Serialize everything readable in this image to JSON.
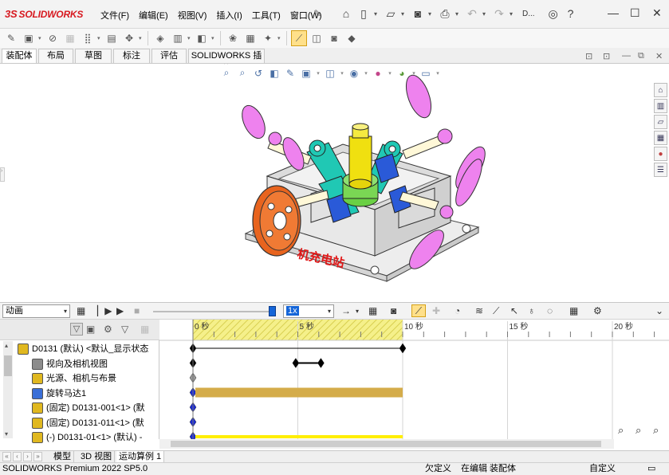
{
  "app": {
    "logo_prefix": "3S",
    "logo_text": "SOLIDWORKS",
    "user_short": "D..."
  },
  "menu": [
    "文件(F)",
    "编辑(E)",
    "视图(V)",
    "插入(I)",
    "工具(T)",
    "窗口(W)"
  ],
  "tabs": [
    "装配体",
    "布局",
    "草图",
    "标注",
    "评估",
    "SOLIDWORKS 插件"
  ],
  "viewport": {
    "watermark": "机充电站"
  },
  "motion_toolbar": {
    "study_type": "动画",
    "speed": "1x"
  },
  "tree": {
    "rows": [
      {
        "label": "D0131 (默认) <默认_显示状态",
        "expand": "▾"
      },
      {
        "label": "视向及相机视图",
        "expand": ""
      },
      {
        "label": "光源、相机与布景",
        "expand": "▸"
      },
      {
        "label": "旋转马达1",
        "expand": ""
      },
      {
        "label": "(固定) D0131-001<1> (默",
        "expand": "▸"
      },
      {
        "label": "(固定) D0131-011<1> (默",
        "expand": "▸"
      },
      {
        "label": "(-) D0131-01<1> (默认) -",
        "expand": "▸"
      }
    ]
  },
  "timeline": {
    "ticks": [
      {
        "label": "0 秒",
        "t": 0
      },
      {
        "label": "5 秒",
        "t": 5
      },
      {
        "label": "10 秒",
        "t": 10
      },
      {
        "label": "15 秒",
        "t": 15
      },
      {
        "label": "20 秒",
        "t": 20
      }
    ],
    "duration": 10
  },
  "bottom_tabs": [
    "模型",
    "3D 视图",
    "运动算例 1"
  ],
  "status": {
    "product": "SOLIDWORKS Premium 2022 SP5.0",
    "defined": "欠定义",
    "editing": "在编辑 装配体",
    "custom": "自定义"
  },
  "colors": {
    "propeller": "#ee82ee",
    "housing": "#e6e6e6",
    "pulley": "#e8641e",
    "shaft": "#f0e010",
    "link": "#20c8b4",
    "timeline_hatch": "#f5f08a",
    "motor_bar": "#d4ac4a",
    "key_blue": "#1a2ad6"
  }
}
